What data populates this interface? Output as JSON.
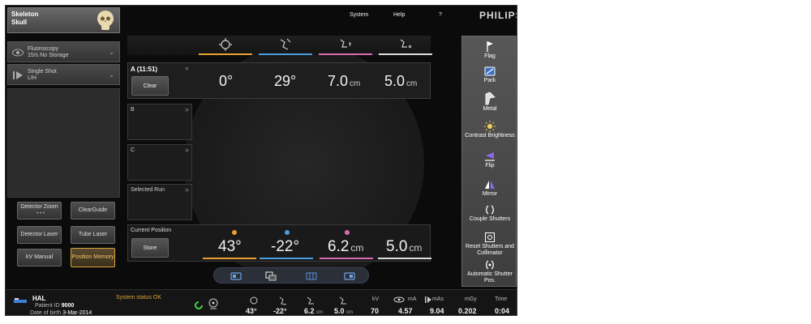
{
  "exam": {
    "line1": "Skeleton",
    "line2": "Skull"
  },
  "protocols": [
    {
      "line1": "Fluoroscopy",
      "line2": "15/s No Storage",
      "icon": "eye-icon"
    },
    {
      "line1": "Single Shot",
      "line2": "LIH",
      "icon": "single-shot-icon"
    }
  ],
  "left_buttons": {
    "detector_zoom": "Detector Zoom",
    "detector_zoom_dots": "• • •",
    "clearguide": "ClearGuide",
    "detector_laser": "Detector Laser",
    "tube_laser": "Tube Laser",
    "kv_manual": "kV Manual",
    "position_memory": "Position Memory"
  },
  "top_menu": {
    "system": "System",
    "help": "Help",
    "question": "?",
    "brand": "PHILIPS"
  },
  "colors": {
    "orange": "#e8a232",
    "blue": "#4a9fe0",
    "pink": "#d96bb0",
    "white": "#dddddd",
    "amber_border": "#d7a53b"
  },
  "runs": {
    "a": {
      "label": "A (11:51)",
      "collapse": "«",
      "button": "Clear",
      "values": [
        {
          "value": "0°",
          "unit": ""
        },
        {
          "value": "29°",
          "unit": ""
        },
        {
          "value": "7.0",
          "unit": "cm"
        },
        {
          "value": "5.0",
          "unit": "cm"
        }
      ]
    },
    "b": {
      "label": "B",
      "expand": "»"
    },
    "c": {
      "label": "C",
      "expand": "»"
    },
    "selected": {
      "label": "Selected Run",
      "expand": "»"
    }
  },
  "current_position": {
    "label": "Current Position",
    "button": "Store",
    "values": [
      {
        "value": "43°",
        "unit": ""
      },
      {
        "value": "-22°",
        "unit": ""
      },
      {
        "value": "6.2",
        "unit": "cm"
      },
      {
        "value": "5.0",
        "unit": "cm"
      }
    ]
  },
  "tools": [
    {
      "label": "Flag",
      "icon": "flag-icon"
    },
    {
      "label": "Park",
      "icon": "park-icon"
    },
    {
      "label": "Metal",
      "icon": "metal-icon"
    },
    {
      "label": "Contrast Brightness",
      "icon": "contrast-brightness-icon"
    },
    {
      "label": "Flip",
      "icon": "flip-icon"
    },
    {
      "label": "Mirror",
      "icon": "mirror-icon"
    },
    {
      "label": "Couple Shutters",
      "icon": "couple-shutters-icon"
    },
    {
      "label": "Reset Shutters and Collimator",
      "icon": "reset-shutters-icon"
    },
    {
      "label": "Automatic Shutter Pos.",
      "icon": "automatic-shutter-icon"
    }
  ],
  "status": {
    "patient_name": "HAL",
    "patient_id_label": "Patient ID",
    "patient_id": "9000",
    "dob_label": "Date of birth",
    "dob": "3-Mar-2014",
    "system_status": "System status OK",
    "positions": [
      {
        "value": "43°",
        "unit": ""
      },
      {
        "value": "-22°",
        "unit": ""
      },
      {
        "value": "6.2",
        "unit": "cm"
      },
      {
        "value": "5.0",
        "unit": "cm"
      }
    ],
    "kv_label": "kV",
    "kv": "70",
    "ma_label": "mA",
    "ma": "4.57",
    "mas_label": "mAs",
    "mas": "9.04",
    "mgy_label": "mGy",
    "mgy": "0.202",
    "time_label": "Time",
    "time": "0:04"
  }
}
